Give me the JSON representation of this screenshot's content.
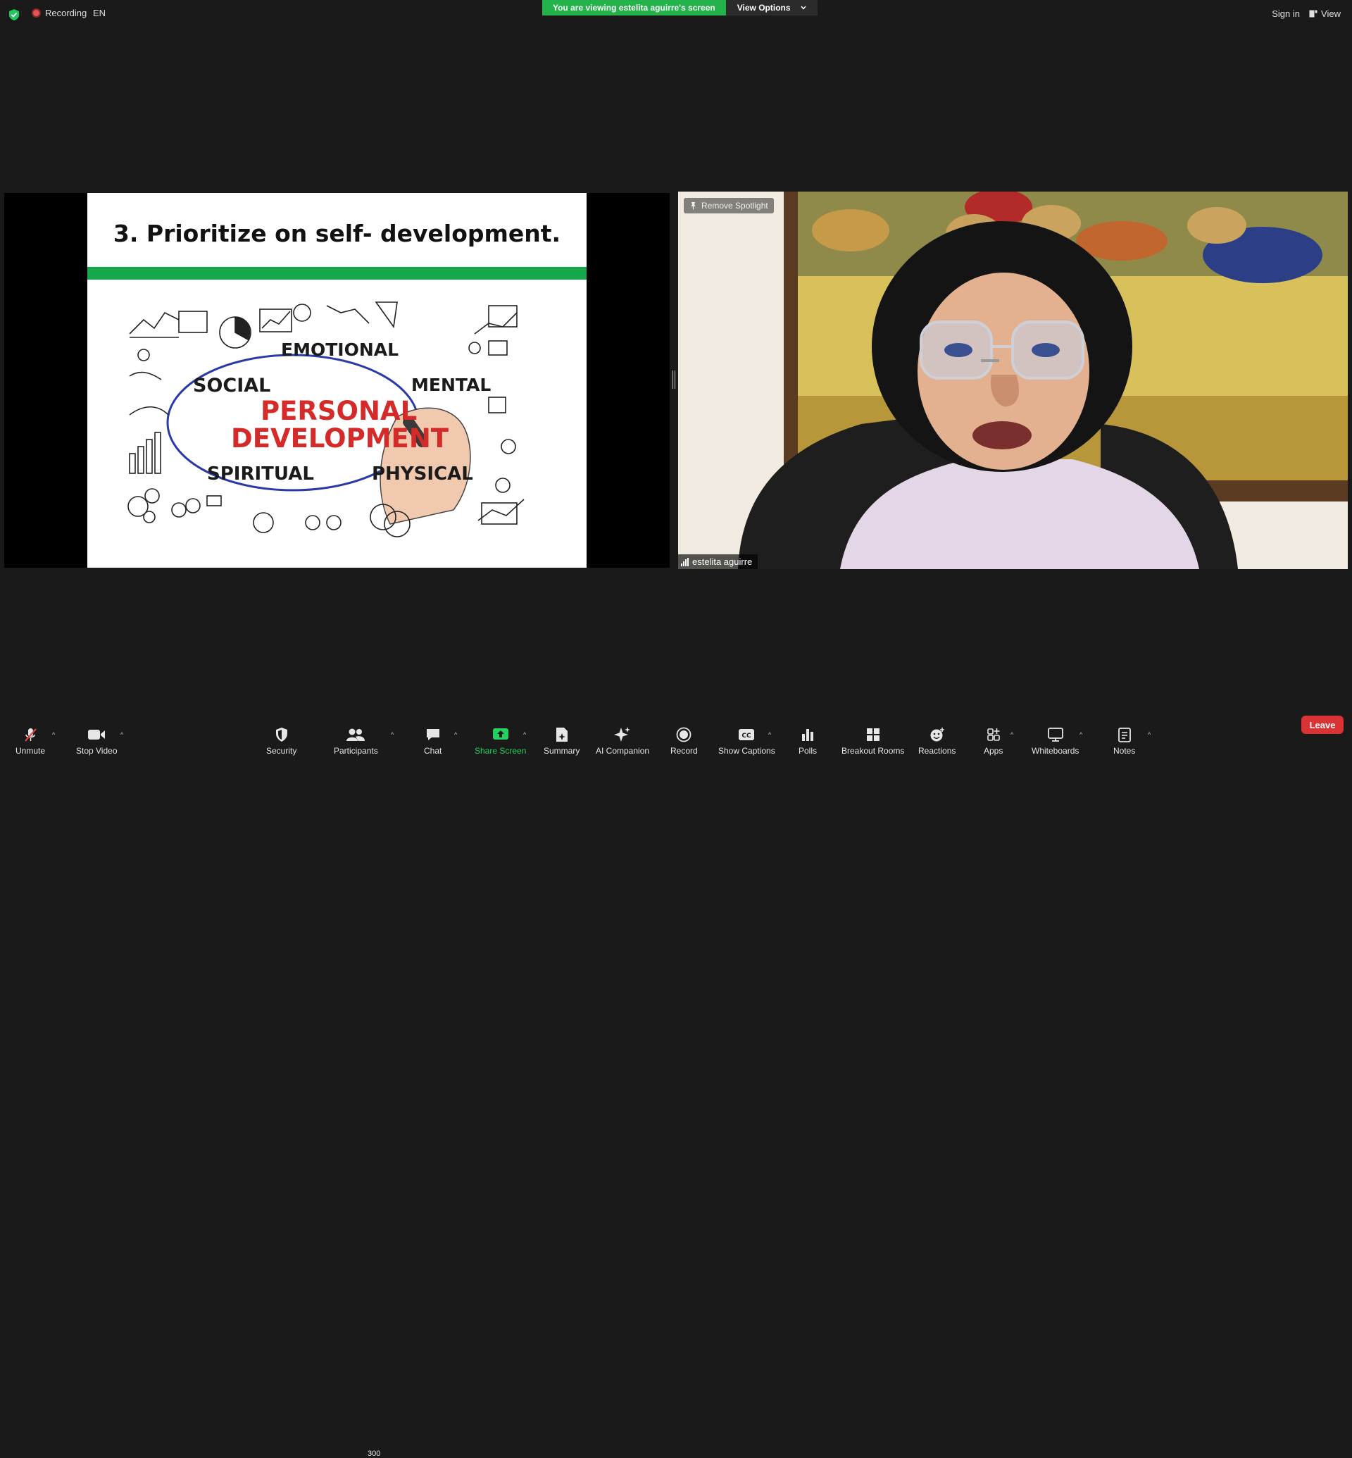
{
  "topbar": {
    "recording_label": "Recording",
    "language": "EN",
    "banner_text": "You are viewing estelita aguirre's screen",
    "view_options_label": "View Options",
    "sign_in_label": "Sign in",
    "view_label": "View"
  },
  "slide": {
    "title": "3. Prioritize on self- development.",
    "words": {
      "emotional": "EMOTIONAL",
      "social": "SOCIAL",
      "mental": "MENTAL",
      "personal": "PERSONAL",
      "development": "DEVELOPMENT",
      "spiritual": "SPIRITUAL",
      "physical": "PHYSICAL"
    }
  },
  "video": {
    "remove_spotlight_label": "Remove Spotlight",
    "participant_name": "estelita aguirre"
  },
  "toolbar": {
    "unmute": "Unmute",
    "stop_video": "Stop Video",
    "security": "Security",
    "participants": "Participants",
    "participant_count": "300",
    "chat": "Chat",
    "share_screen": "Share Screen",
    "summary": "Summary",
    "ai_companion": "AI Companion",
    "record": "Record",
    "show_captions": "Show Captions",
    "polls": "Polls",
    "breakout_rooms": "Breakout Rooms",
    "reactions": "Reactions",
    "apps": "Apps",
    "whiteboards": "Whiteboards",
    "notes": "Notes",
    "leave": "Leave"
  },
  "colors": {
    "banner_green": "#24b24a",
    "share_screen_green": "#23d160",
    "leave_red": "#d93333",
    "slide_red": "#d42a2a",
    "slide_bar_green": "#15a84a",
    "background": "#1a1a1a"
  },
  "icons": [
    "shield-icon",
    "recording-dot-icon",
    "chevron-down-icon",
    "view-icon",
    "pin-icon",
    "signal-bars-icon",
    "mic-off-icon",
    "video-camera-icon",
    "security-shield-icon",
    "participants-icon",
    "chat-icon",
    "share-screen-icon",
    "summary-icon",
    "ai-sparkle-icon",
    "record-icon",
    "captions-icon",
    "polls-icon",
    "breakout-rooms-icon",
    "reactions-icon",
    "apps-icon",
    "whiteboard-icon",
    "notes-icon"
  ]
}
